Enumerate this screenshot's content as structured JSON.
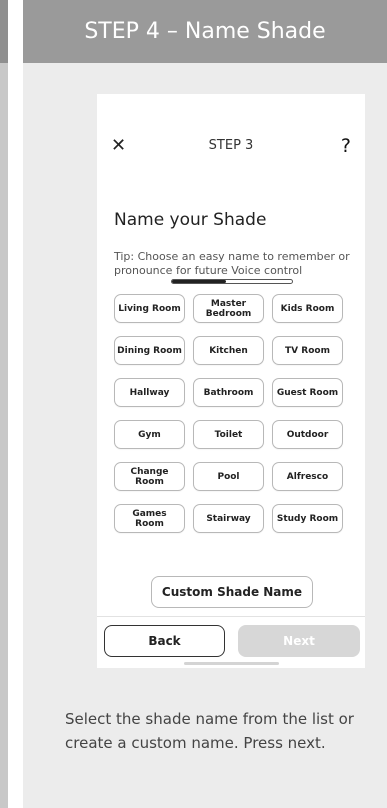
{
  "header": {
    "title": "STEP 4 – Name Shade"
  },
  "phone": {
    "step_label": "STEP 3",
    "progress_fraction": 0.45,
    "title": "Name your Shade",
    "tip": "Tip: Choose an easy name to remember or pronounce for future Voice control",
    "rooms": [
      [
        "Living Room",
        "Master Bedroom",
        "Kids Room"
      ],
      [
        "Dining Room",
        "Kitchen",
        "TV Room"
      ],
      [
        "Hallway",
        "Bathroom",
        "Guest Room"
      ],
      [
        "Gym",
        "Toilet",
        "Outdoor"
      ],
      [
        "Change Room",
        "Pool",
        "Alfresco"
      ],
      [
        "Games Room",
        "Stairway",
        "Study Room"
      ]
    ],
    "custom_name": "Custom Shade Name",
    "back": "Back",
    "next": "Next"
  },
  "footer": {
    "instructions": "Select the shade name from the list or create a custom name. Press next."
  },
  "icons": {
    "close": "close-icon",
    "help": "question-icon"
  },
  "colors": {
    "header": "#9a9a9a",
    "card": "#ececec",
    "next_disabled": "#d7d7d7"
  }
}
